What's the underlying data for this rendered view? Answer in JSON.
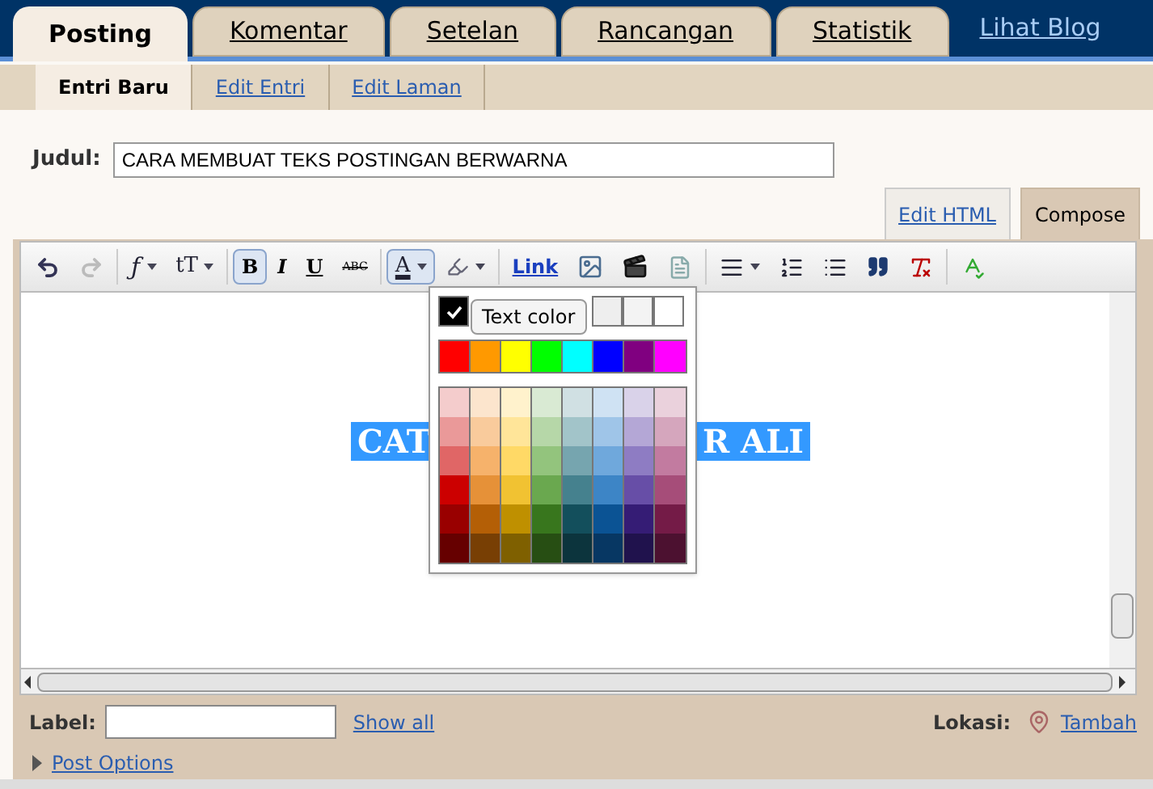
{
  "tabs": [
    {
      "label": "Posting",
      "selected": true
    },
    {
      "label": "Komentar",
      "selected": false
    },
    {
      "label": "Setelan",
      "selected": false
    },
    {
      "label": "Rancangan",
      "selected": false
    },
    {
      "label": "Statistik",
      "selected": false
    }
  ],
  "view_blog_link": "Lihat Blog",
  "subtabs": [
    {
      "label": "Entri Baru",
      "selected": true
    },
    {
      "label": "Edit Entri",
      "selected": false
    },
    {
      "label": "Edit Laman",
      "selected": false
    }
  ],
  "title_field": {
    "label": "Judul:",
    "value": "CARA MEMBUAT TEKS POSTINGAN BERWARNA"
  },
  "mode_tabs": [
    {
      "label": "Edit HTML",
      "selected": false
    },
    {
      "label": "Compose",
      "selected": true
    }
  ],
  "toolbar": [
    [
      {
        "kind": "undo",
        "disabled": false
      },
      {
        "kind": "redo",
        "disabled": true
      }
    ],
    [
      {
        "kind": "font",
        "label": "ƒ",
        "dropdown": true
      },
      {
        "kind": "size",
        "label": "tT",
        "dropdown": true
      }
    ],
    [
      {
        "kind": "bold",
        "label": "B",
        "pressed": true
      },
      {
        "kind": "italic",
        "label": "I",
        "pressed": false
      },
      {
        "kind": "underline",
        "label": "U",
        "pressed": false
      },
      {
        "kind": "strike",
        "label": "ABC",
        "pressed": false
      }
    ],
    [
      {
        "kind": "textcolor",
        "label": "A",
        "dropdown": true,
        "pressed": true
      },
      {
        "kind": "highlight",
        "dropdown": true
      }
    ],
    [
      {
        "kind": "link",
        "label": "Link"
      },
      {
        "kind": "image"
      },
      {
        "kind": "video"
      },
      {
        "kind": "jumpbreak"
      }
    ],
    [
      {
        "kind": "align",
        "dropdown": true
      },
      {
        "kind": "numbered"
      },
      {
        "kind": "bulleted"
      },
      {
        "kind": "quote"
      },
      {
        "kind": "clearformat"
      }
    ],
    [
      {
        "kind": "spellcheck"
      }
    ]
  ],
  "content": {
    "selected_text_left": "CAT",
    "selected_text_right": "R ALI"
  },
  "color_menu": {
    "tooltip": "Text color",
    "grey_row": [
      {
        "color": "#000000",
        "selected": true
      },
      {
        "color": "#eeeeee",
        "selected": false
      },
      {
        "color": "#f3f3f3",
        "selected": false
      },
      {
        "color": "#ffffff",
        "selected": false
      }
    ],
    "bright_row": [
      {
        "color": "#ff0000"
      },
      {
        "color": "#ff9900"
      },
      {
        "color": "#ffff00"
      },
      {
        "color": "#00ff00"
      },
      {
        "color": "#00ffff"
      },
      {
        "color": "#0000ff"
      },
      {
        "color": "#800080"
      },
      {
        "color": "#ff00ff"
      }
    ],
    "palette": [
      [
        {
          "color": "#f4cccc"
        },
        {
          "color": "#fce5cd"
        },
        {
          "color": "#fff2cc"
        },
        {
          "color": "#d9ead3"
        },
        {
          "color": "#d0e0e3"
        },
        {
          "color": "#cfe2f3"
        },
        {
          "color": "#d9d2e9"
        },
        {
          "color": "#ead1dc"
        }
      ],
      [
        {
          "color": "#ea9999"
        },
        {
          "color": "#f9cb9c"
        },
        {
          "color": "#ffe599"
        },
        {
          "color": "#b6d7a8"
        },
        {
          "color": "#a2c4c9"
        },
        {
          "color": "#9fc5e8"
        },
        {
          "color": "#b4a7d6"
        },
        {
          "color": "#d5a6bd"
        }
      ],
      [
        {
          "color": "#e06666"
        },
        {
          "color": "#f6b26b"
        },
        {
          "color": "#ffd966"
        },
        {
          "color": "#93c47d"
        },
        {
          "color": "#76a5af"
        },
        {
          "color": "#6fa8dc"
        },
        {
          "color": "#8e7cc3"
        },
        {
          "color": "#c27ba0"
        }
      ],
      [
        {
          "color": "#cc0000"
        },
        {
          "color": "#e69138"
        },
        {
          "color": "#f1c232"
        },
        {
          "color": "#6aa84f"
        },
        {
          "color": "#45818e"
        },
        {
          "color": "#3d85c6"
        },
        {
          "color": "#674ea7"
        },
        {
          "color": "#a64d79"
        }
      ],
      [
        {
          "color": "#990000"
        },
        {
          "color": "#b45f06"
        },
        {
          "color": "#bf9000"
        },
        {
          "color": "#38761d"
        },
        {
          "color": "#134f5c"
        },
        {
          "color": "#0b5394"
        },
        {
          "color": "#351c75"
        },
        {
          "color": "#741b47"
        }
      ],
      [
        {
          "color": "#660000"
        },
        {
          "color": "#783f04"
        },
        {
          "color": "#7f6000"
        },
        {
          "color": "#274e13"
        },
        {
          "color": "#0c343d"
        },
        {
          "color": "#073763"
        },
        {
          "color": "#20124d"
        },
        {
          "color": "#4c1130"
        }
      ]
    ]
  },
  "footer": {
    "label_field": {
      "label": "Label:"
    },
    "show_all": "Show all",
    "location_label": "Lokasi:",
    "add_location": "Tambah",
    "post_options": {
      "label": "Post Options",
      "expanded": false
    }
  }
}
